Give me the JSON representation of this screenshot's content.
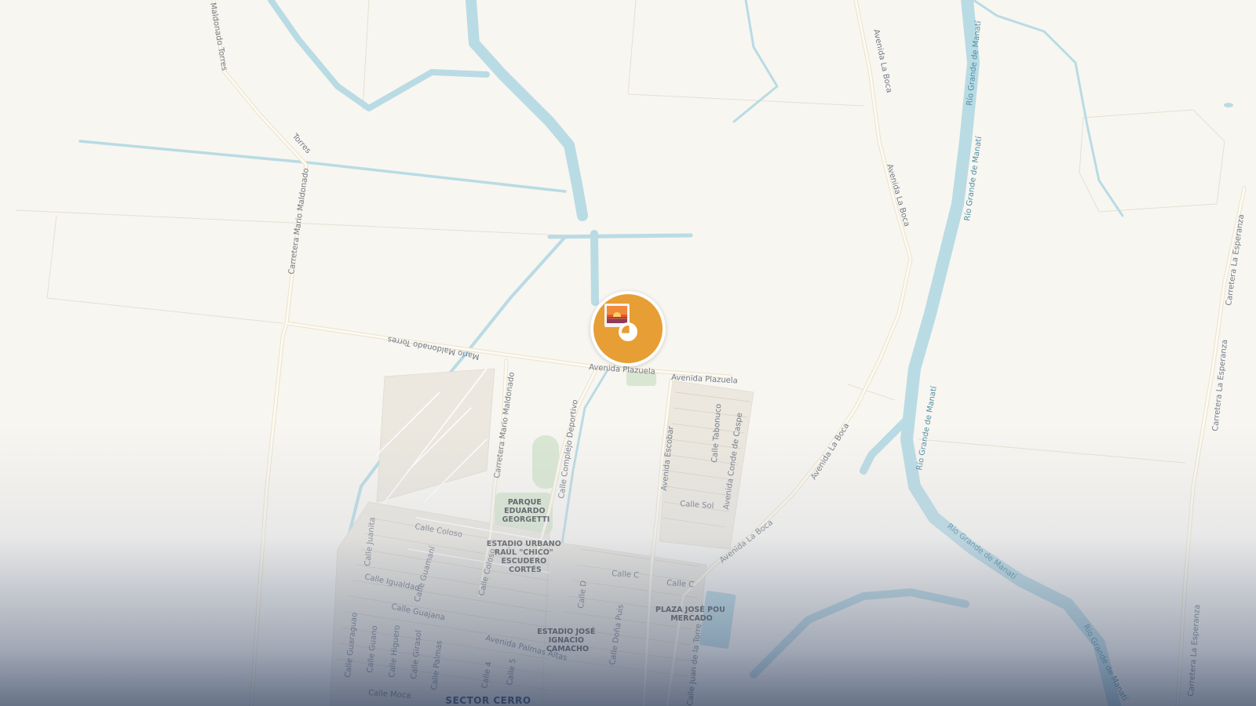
{
  "map": {
    "colors": {
      "land": "#f8f6f1",
      "water": "#b9dbe4",
      "road": "#fcfaf4",
      "road_casing": "#eadfc8",
      "marker": "#e79e34"
    },
    "roads": {
      "mario_maldonado_torres_top": "Maldonado Torres",
      "mario_maldonado_torres_mid": "Torres",
      "carretera_mario_maldonado_a": "Carretera Mario Maldonado",
      "mario_maldonado_torres_low": "Mario Maldonado Torres",
      "carretera_mario_maldonado_b": "Carretera Mario Maldonado",
      "avenida_la_boca_1": "Avenida La Boca",
      "avenida_la_boca_2": "Avenida La Boca",
      "avenida_la_boca_3": "Avenida La Boca",
      "avenida_la_boca_4": "Avenida La Boca",
      "avenida_plazuela_1": "Avenida Plazuela",
      "avenida_plazuela_2": "Avenida Plazuela",
      "calle_complejo_deportivo": "Calle Complejo Deportivo",
      "avenida_escobar": "Avenida Escobar",
      "calle_tabonuco": "Calle Tabonuco",
      "avenida_conde_de_caspe": "Avenida Conde de Caspe",
      "calle_sol": "Calle Sol",
      "calle_c_1": "Calle C",
      "calle_c_2": "Calle C",
      "calle_d": "Calle D",
      "calle_dona_puis": "Calle Doña Puis",
      "calle_juan_de_la_torre": "Calle Juan de la Torre",
      "carretera_la_esperanza_1": "Carretera La Esperanza",
      "carretera_la_esperanza_2": "Carretera La Esperanza",
      "carretera_la_esperanza_3": "Carretera La Esperanza",
      "calle_coloso_1": "Calle Coloso",
      "calle_coloso_2": "Calle Coloso",
      "calle_juanita": "Calle Juanita",
      "calle_guamani": "Calle Guamaní",
      "calle_igualdad": "Calle Igualdad",
      "calle_guajana": "Calle Guajana",
      "avenida_palmas_altas": "Avenida Palmas Altas",
      "calle_guaraguao": "Calle Guaraguao",
      "calle_guano": "Calle Guano",
      "calle_higuero": "Calle Higuero",
      "calle_girasol": "Calle Girasol",
      "calle_palmas": "Calle Palmas",
      "calle_4": "Calle 4",
      "calle_5": "Calle 5",
      "calle_moca": "Calle Moca"
    },
    "rivers": {
      "rio_manati_1": "Río Grande de Manatí",
      "rio_manati_2": "Río Grande de Manatí",
      "rio_manati_3": "Río Grande de Manatí",
      "rio_manati_4": "Río Grande de Manatí",
      "rio_manati_5": "Río Grande de Manatí"
    },
    "pois": {
      "parque_eduardo_georgetti": [
        "PARQUE",
        "EDUARDO",
        "GEORGETTI"
      ],
      "estadio_raul_chico": [
        "ESTADIO URBANO",
        "RAÚL \"CHICO\"",
        "ESCUDERO",
        "CORTÉS"
      ],
      "estadio_ignacio_camacho": [
        "ESTADIO JOSÉ",
        "IGNACIO",
        "CAMACHO"
      ],
      "plaza_jose_pou": [
        "PLAZA JOSÉ POU",
        "MERCADO"
      ]
    },
    "districts": {
      "sector_cerro": "SECTOR CERRO"
    },
    "marker": {
      "icon": "photo-sunset-icon",
      "count_icon": "cluster-count-ring"
    }
  }
}
